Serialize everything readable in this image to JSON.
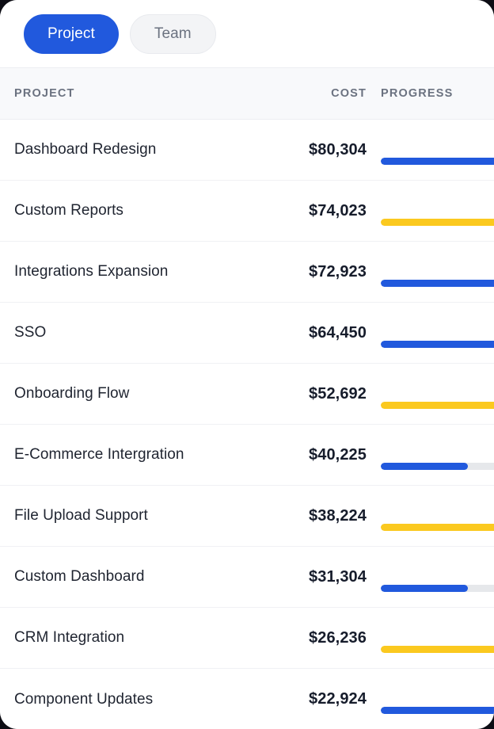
{
  "toggle": {
    "options": [
      {
        "label": "Project",
        "state": "active"
      },
      {
        "label": "Team",
        "state": "inactive"
      }
    ]
  },
  "colors": {
    "accent_blue": "#2159dd",
    "accent_yellow": "#fbc91f",
    "track_gray": "#e6e8eb",
    "header_bg": "#f8f9fb",
    "divider": "#f0f1f4",
    "text_primary": "#1f2430",
    "text_muted": "#6b7280"
  },
  "table": {
    "headers": {
      "project": "PROJECT",
      "cost": "COST",
      "progress": "PROGRESS"
    },
    "rows": [
      {
        "project": "Dashboard Redesign",
        "cost": "$80,304",
        "progress_pct": 100,
        "bar_color": "#2159dd"
      },
      {
        "project": "Custom Reports",
        "cost": "$74,023",
        "progress_pct": 100,
        "bar_color": "#fbc91f"
      },
      {
        "project": "Integrations Expansion",
        "cost": "$72,923",
        "progress_pct": 100,
        "bar_color": "#2159dd"
      },
      {
        "project": "SSO",
        "cost": "$64,450",
        "progress_pct": 100,
        "bar_color": "#2159dd"
      },
      {
        "project": "Onboarding Flow",
        "cost": "$52,692",
        "progress_pct": 100,
        "bar_color": "#fbc91f"
      },
      {
        "project": "E-Commerce Intergration",
        "cost": "$40,225",
        "progress_pct": 55,
        "bar_color": "#2159dd"
      },
      {
        "project": "File Upload Support",
        "cost": "$38,224",
        "progress_pct": 100,
        "bar_color": "#fbc91f"
      },
      {
        "project": "Custom Dashboard",
        "cost": "$31,304",
        "progress_pct": 55,
        "bar_color": "#2159dd"
      },
      {
        "project": "CRM Integration",
        "cost": "$26,236",
        "progress_pct": 100,
        "bar_color": "#fbc91f"
      },
      {
        "project": "Component Updates",
        "cost": "$22,924",
        "progress_pct": 100,
        "bar_color": "#2159dd"
      }
    ]
  }
}
